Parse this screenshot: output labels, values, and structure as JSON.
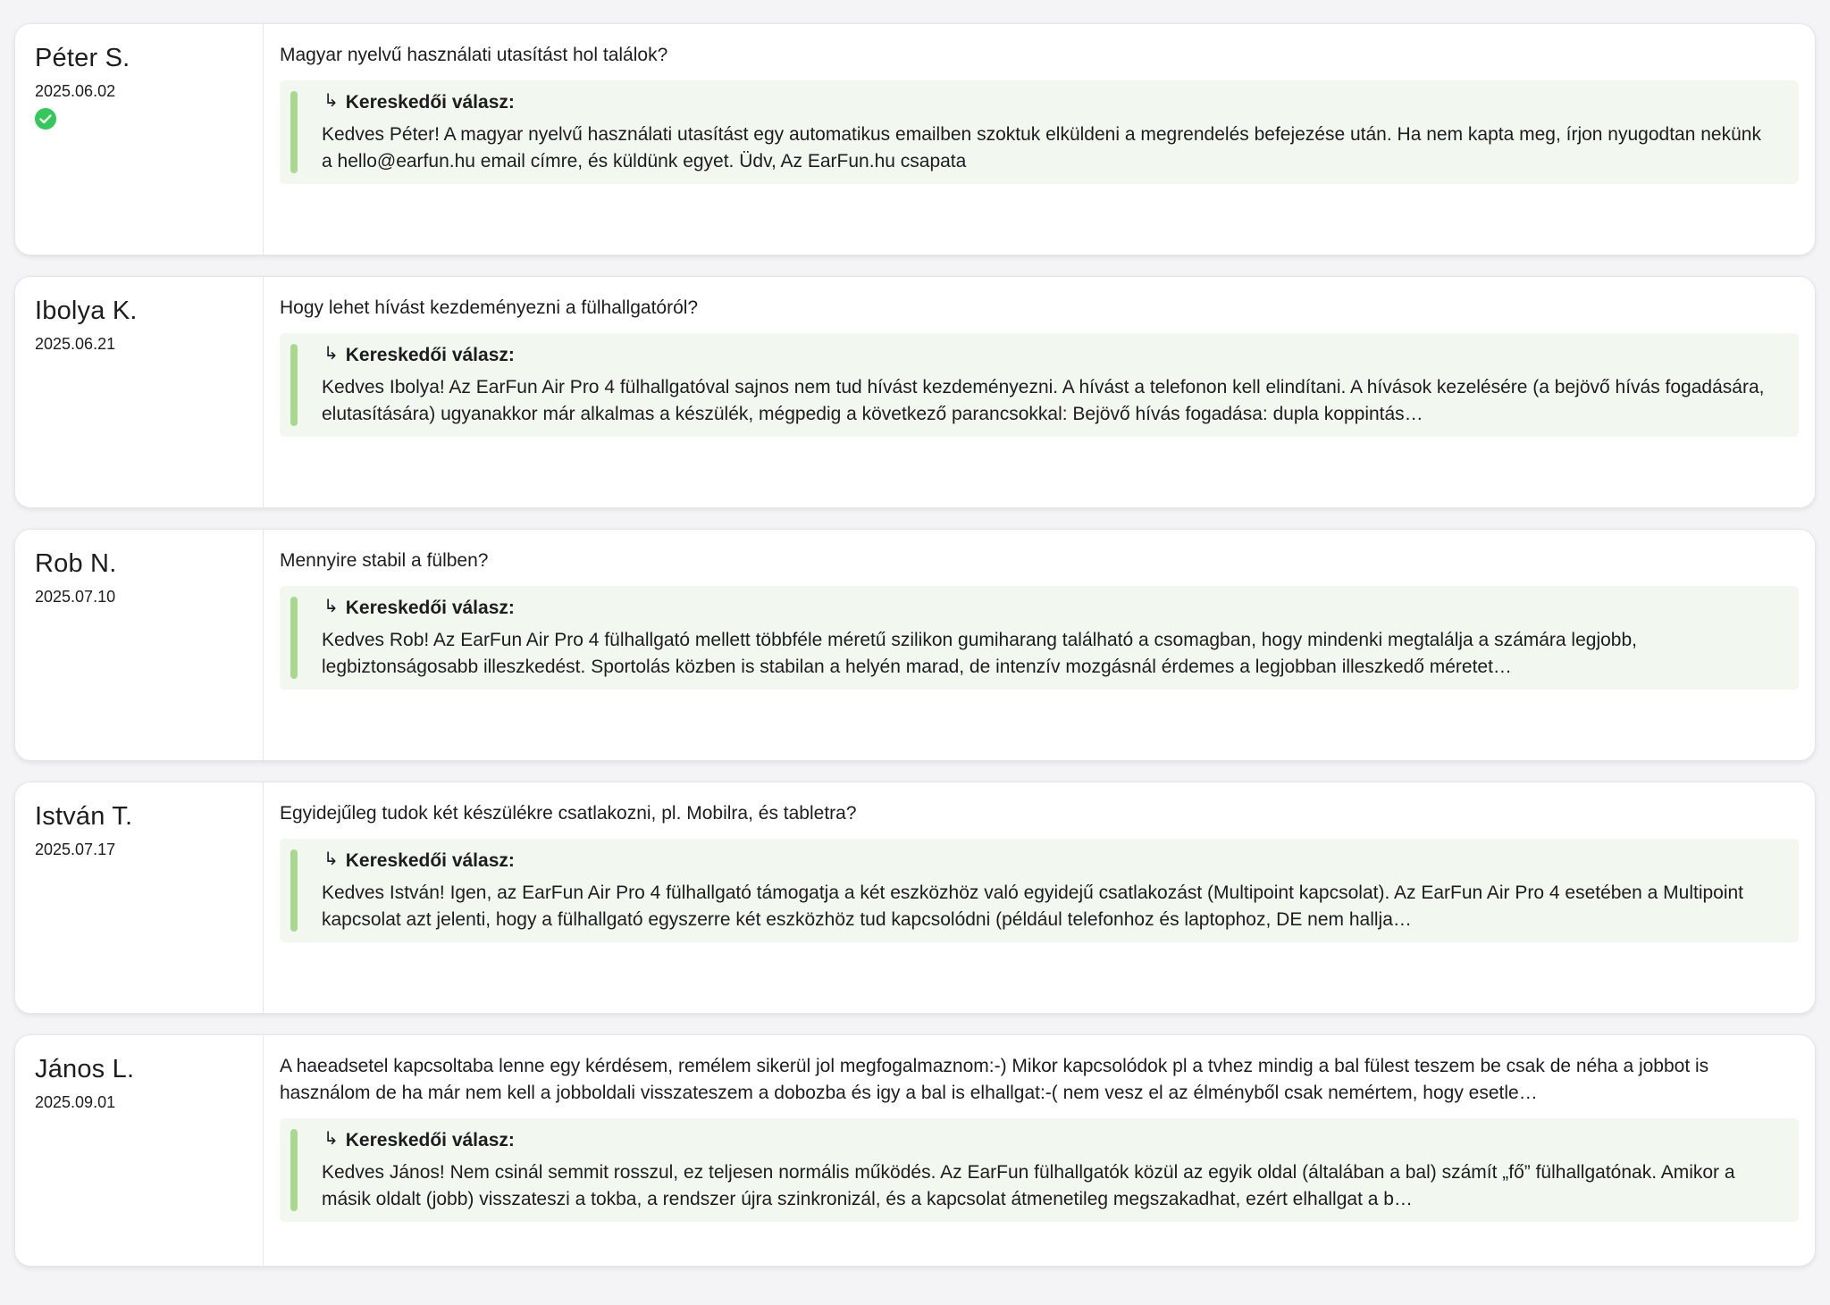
{
  "reply_label": "Kereskedői válasz:",
  "accent_green": "#a8d98f",
  "verified_color": "#34c759",
  "reviews": [
    {
      "name": "Péter S.",
      "date": "2025.06.02",
      "verified": true,
      "question": "Magyar nyelvű használati utasítást hol találok?",
      "reply": "Kedves Péter! A magyar nyelvű használati utasítást egy automatikus emailben szoktuk elküldeni a megrendelés befejezése után. Ha nem kapta meg, írjon nyugodtan nekünk a hello@earfun.hu email címre, és küldünk egyet. Üdv, Az EarFun.hu csapata"
    },
    {
      "name": "Ibolya K.",
      "date": "2025.06.21",
      "verified": false,
      "question": "Hogy lehet hívást kezdeményezni a fülhallgatóról?",
      "reply": "Kedves Ibolya! Az EarFun Air Pro 4 fülhallgatóval sajnos nem tud hívást kezdeményezni. A hívást a telefonon kell elindítani. A hívások kezelésére (a bejövő hívás fogadására, elutasítására) ugyanakkor már alkalmas a készülék, mégpedig a következő parancsokkal: Bejövő hívás fogadása: dupla koppintás…"
    },
    {
      "name": "Rob N.",
      "date": "2025.07.10",
      "verified": false,
      "question": "Mennyire stabil a fülben?",
      "reply": "Kedves Rob! Az EarFun Air Pro 4 fülhallgató mellett többféle méretű szilikon gumiharang található a csomagban, hogy mindenki megtalálja a számára legjobb, legbiztonságosabb illeszkedést. Sportolás közben is stabilan a helyén marad, de intenzív mozgásnál érdemes a legjobban illeszkedő méretet…"
    },
    {
      "name": "István T.",
      "date": "2025.07.17",
      "verified": false,
      "question": "Egyidejűleg tudok két készülékre csatlakozni, pl. Mobilra, és tabletra?",
      "reply": "Kedves István! Igen, az EarFun Air Pro 4 fülhallgató támogatja a két eszközhöz való egyidejű csatlakozást (Multipoint kapcsolat). Az EarFun Air Pro 4 esetében a Multipoint kapcsolat azt jelenti, hogy a fülhallgató egyszerre két eszközhöz tud kapcsolódni (például telefonhoz és laptophoz, DE nem hallja…"
    },
    {
      "name": "János L.",
      "date": "2025.09.01",
      "verified": false,
      "question": "A haeadsetel kapcsoltaba lenne egy kérdésem, remélem sikerül jol megfogalmaznom:-) Mikor kapcsolódok pl a tvhez mindig a bal fülest teszem be csak de néha a jobbot is használom de ha már nem kell a jobboldali visszateszem a dobozba és igy a bal is elhallgat:-( nem vesz el az élményből csak nemértem, hogy esetle…",
      "reply": "Kedves János! Nem csinál semmit rosszul, ez teljesen normális működés. Az EarFun fülhallgatók közül az egyik oldal (általában a bal) számít „fő” fülhallgatónak. Amikor a másik oldalt (jobb) visszateszi a tokba, a rendszer újra szinkronizál, és a kapcsolat átmenetileg megszakadhat, ezért elhallgat a b…"
    }
  ]
}
